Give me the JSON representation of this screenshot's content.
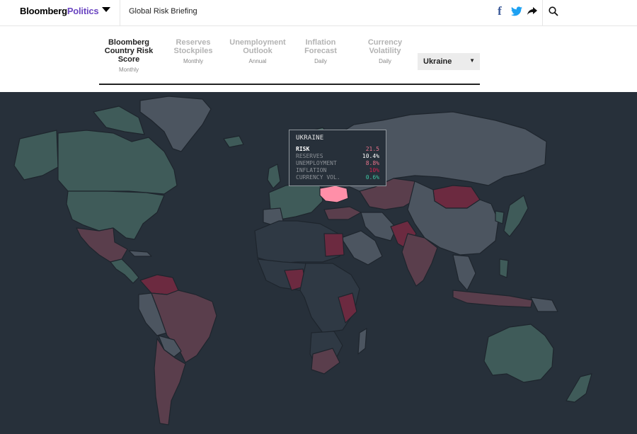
{
  "header": {
    "brand_bold": "Bloomberg",
    "brand_colored": "Politics",
    "title": "Global Risk Briefing",
    "icons": [
      "facebook-icon",
      "twitter-icon",
      "share-icon",
      "search-icon"
    ],
    "facebook_glyph": "f"
  },
  "tabs": [
    {
      "label_lines": [
        "Bloomberg",
        "Country Risk",
        "Score"
      ],
      "sub": "Monthly",
      "active": true
    },
    {
      "label_lines": [
        "Reserves",
        "Stockpiles"
      ],
      "sub": "Monthly",
      "active": false
    },
    {
      "label_lines": [
        "Unemployment",
        "Outlook"
      ],
      "sub": "Annual",
      "active": false
    },
    {
      "label_lines": [
        "Inflation",
        "Forecast"
      ],
      "sub": "Daily",
      "active": false
    },
    {
      "label_lines": [
        "Currency",
        "Volatility"
      ],
      "sub": "Daily",
      "active": false
    }
  ],
  "country_select": {
    "value": "Ukraine",
    "arrow": "▼"
  },
  "tooltip": {
    "country": "UKRAINE",
    "rows": [
      {
        "label": "RISK",
        "value": "21.5",
        "color": "#e8738c"
      },
      {
        "label": "RESERVES",
        "value": "10.4%",
        "color": "#ffffff"
      },
      {
        "label": "UNEMPLOYMENT",
        "value": "8.8%",
        "color": "#e8738c"
      },
      {
        "label": "INFLATION",
        "value": "10%",
        "color": "#d6204f"
      },
      {
        "label": "CURRENCY VOL.",
        "value": "0.6%",
        "color": "#3fc6a3"
      }
    ]
  },
  "colors": {
    "map_background": "#27303a",
    "low_risk": "#3f5b59",
    "neutral": "#4c5560",
    "elevated": "#5a3e4c",
    "high": "#6c2a40",
    "selected": "#ff8fa8",
    "brand_accent": "#6b46c1"
  }
}
